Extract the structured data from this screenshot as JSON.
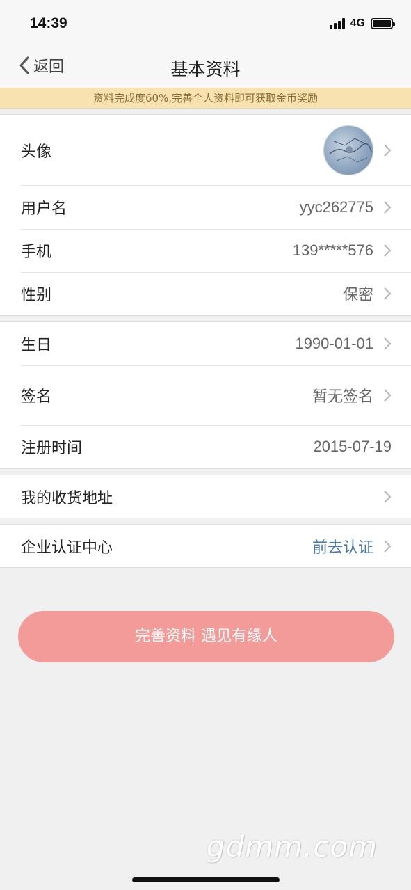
{
  "status": {
    "time": "14:39",
    "network": "4G"
  },
  "nav": {
    "back_label": "返回",
    "title": "基本资料"
  },
  "banner": {
    "text": "资料完成度60%,完善个人资料即可获取金币奖励"
  },
  "group1": {
    "avatar_label": "头像",
    "username_label": "用户名",
    "username_value": "yyc262775",
    "phone_label": "手机",
    "phone_value": "139*****576",
    "gender_label": "性别",
    "gender_value": "保密"
  },
  "group2": {
    "birthday_label": "生日",
    "birthday_value": "1990-01-01",
    "signature_label": "签名",
    "signature_value": "暂无签名",
    "register_label": "注册时间",
    "register_value": "2015-07-19"
  },
  "group3": {
    "address_label": "我的收货地址"
  },
  "group4": {
    "enterprise_label": "企业认证中心",
    "enterprise_value": "前去认证"
  },
  "cta": {
    "label": "完善资料 遇见有缘人"
  },
  "watermark": "gdmm.com",
  "colors": {
    "cta": "#f29b99",
    "banner": "#f7e2b0",
    "link": "#4a79a6"
  }
}
